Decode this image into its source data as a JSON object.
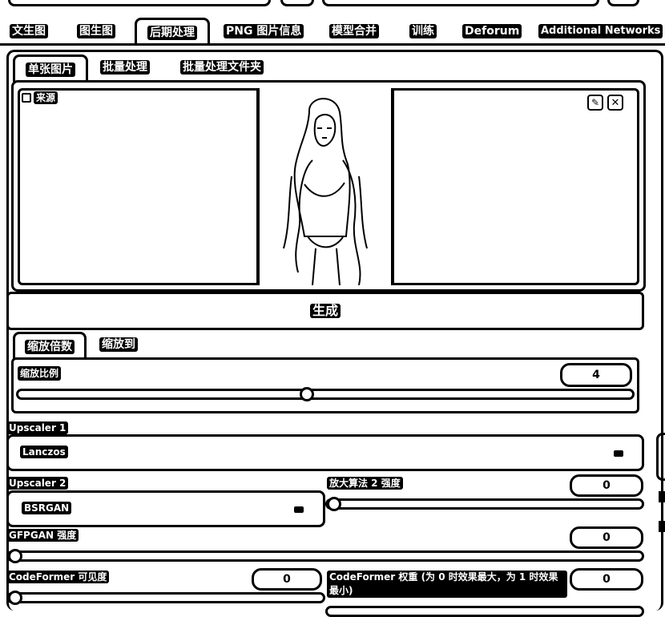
{
  "main_tabs": [
    "文生图",
    "图生图",
    "后期处理",
    "PNG 图片信息",
    "模型合并",
    "训练",
    "Deforum",
    "Additional Networks"
  ],
  "sub_tabs": [
    "单张图片",
    "批量处理",
    "批量处理文件夹"
  ],
  "image_panel": {
    "source_label": "来源"
  },
  "generate_button": "生成",
  "scale_tabs": [
    "缩放倍数",
    "缩放到"
  ],
  "scale": {
    "label": "缩放比例",
    "value": "4",
    "fraction": 0.47
  },
  "upscaler1": {
    "label": "Upscaler 1",
    "value": "Lanczos"
  },
  "upscaler2": {
    "label": "Upscaler 2",
    "value": "BSRGAN"
  },
  "upscaler2_strength": {
    "label": "放大算法 2 强度",
    "value": "0",
    "fraction": 0
  },
  "gfpgan": {
    "label": "GFPGAN 强度",
    "value": "0",
    "fraction": 0
  },
  "codeformer_visibility": {
    "label": "CodeFormer 可见度",
    "value": "0",
    "fraction": 0
  },
  "codeformer_weight": {
    "label": "CodeFormer 权重 (为 0 时效果最大，为 1 时效果最小)",
    "value": "0",
    "fraction": 0
  }
}
